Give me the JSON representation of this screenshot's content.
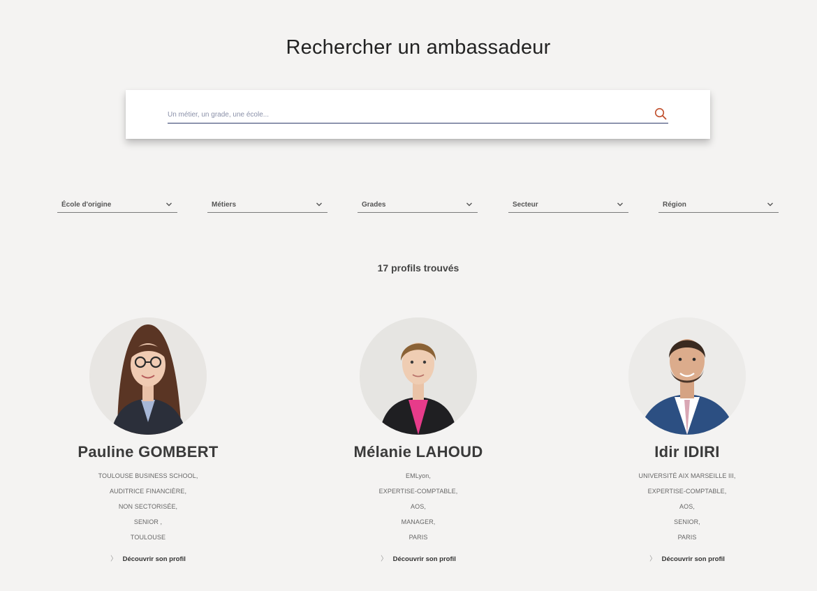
{
  "page": {
    "title": "Rechercher un ambassadeur"
  },
  "search": {
    "placeholder": "Un métier, un grade, une école..."
  },
  "filters": [
    {
      "label": "École d'origine"
    },
    {
      "label": "Métiers"
    },
    {
      "label": "Grades"
    },
    {
      "label": "Secteur"
    },
    {
      "label": "Région"
    }
  ],
  "results": {
    "count_text": "17 profils trouvés"
  },
  "profiles": [
    {
      "name": "Pauline GOMBERT",
      "details": [
        "TOULOUSE BUSINESS SCHOOL,",
        "AUDITRICE FINANCIÈRE,",
        "NON SECTORISÉE,",
        "SENIOR ,",
        "TOULOUSE"
      ],
      "link_label": "Découvrir son profil"
    },
    {
      "name": "Mélanie LAHOUD",
      "details": [
        "EMLyon,",
        "EXPERTISE-COMPTABLE,",
        "AOS,",
        "MANAGER,",
        "PARIS"
      ],
      "link_label": "Découvrir son profil"
    },
    {
      "name": "Idir IDIRI",
      "details": [
        "UNIVERSITÉ AIX MARSEILLE III,",
        "EXPERTISE-COMPTABLE,",
        "AOS,",
        "SENIOR,",
        "PARIS"
      ],
      "link_label": "Découvrir son profil"
    }
  ],
  "colors": {
    "accent": "#c1502e",
    "underline": "#2d3a6a",
    "background": "#f4f3f2"
  },
  "icons": {
    "search": "search-icon",
    "dropdown": "chevron-down-icon",
    "link": "chevron-right-icon"
  }
}
